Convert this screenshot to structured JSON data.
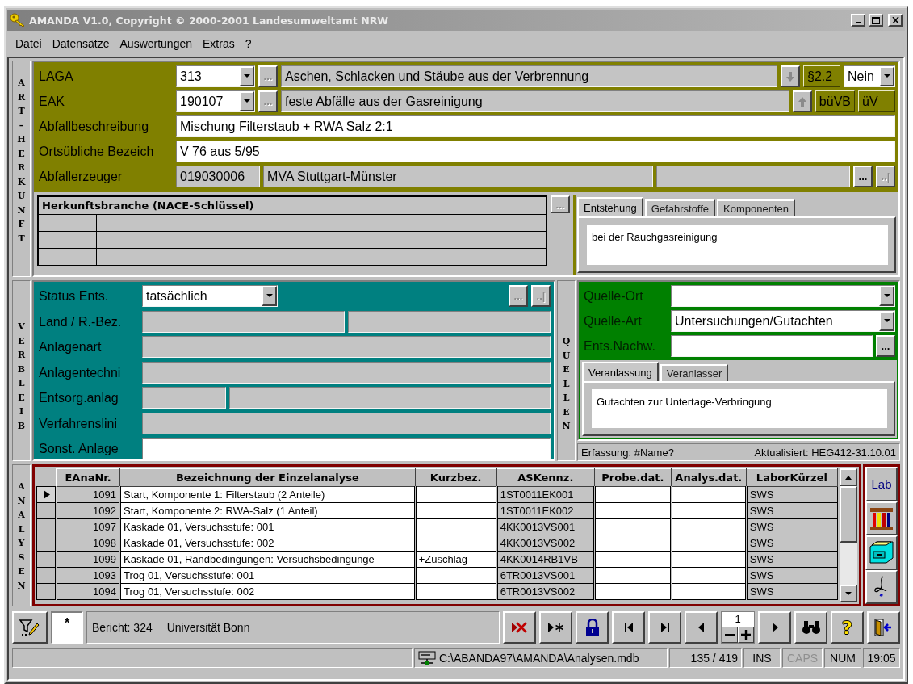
{
  "window": {
    "title": "AMANDA V1.0, Copyright © 2000-2001 Landesumweltamt NRW"
  },
  "menu": [
    "Datei",
    "Datensätze",
    "Auswertungen",
    "Extras",
    "?"
  ],
  "origin": {
    "side_label": "ART–HERKUNFT",
    "rows": [
      {
        "label": "LAGA",
        "items": [
          {
            "kind": "combo",
            "text": "313"
          },
          {
            "kind": "button",
            "text": "...",
            "disabled": true
          },
          {
            "kind": "field",
            "text": "Aschen, Schlacken und Stäube aus der Verbrennung",
            "readonly": true
          },
          {
            "kind": "down_arrow",
            "disabled": true
          },
          {
            "kind": "tag",
            "text": "§2.2"
          },
          {
            "kind": "combo",
            "text": "Nein"
          }
        ]
      },
      {
        "label": "EAK",
        "items": [
          {
            "kind": "combo",
            "text": "190107"
          },
          {
            "kind": "button",
            "text": "...",
            "disabled": true
          },
          {
            "kind": "field",
            "text": "feste Abfälle aus der Gasreinigung",
            "readonly": true
          },
          {
            "kind": "up_arrow",
            "disabled": true
          },
          {
            "kind": "tag",
            "text": "büVB"
          },
          {
            "kind": "tag",
            "text": "üV"
          }
        ]
      },
      {
        "label": "Abfallbeschreibung",
        "items": [
          {
            "kind": "field",
            "text": "Mischung Filterstaub + RWA Salz  2:1",
            "readonly": false
          }
        ]
      },
      {
        "label": "Ortsübliche Bezeich",
        "items": [
          {
            "kind": "field",
            "text": "V 76 aus 5/95",
            "readonly": false
          }
        ]
      },
      {
        "label": "Abfallerzeuger",
        "items": [
          {
            "kind": "field",
            "text": "019030006",
            "readonly": true
          },
          {
            "kind": "field",
            "text": "MVA Stuttgart-Münster",
            "readonly": true
          },
          {
            "kind": "field",
            "readonly": true
          },
          {
            "kind": "button",
            "text": "...",
            "disabled": false
          },
          {
            "kind": "button",
            "text": "..|",
            "disabled": true
          }
        ]
      }
    ],
    "branch_table": {
      "title": "Herkunftsbranche (NACE-Schlüssel)"
    },
    "branch_lookup": {
      "text": "...",
      "disabled": true
    },
    "tabs": [
      {
        "label": "Entstehung",
        "selected": true
      },
      {
        "label": "Gefahrstoffe",
        "selected": false
      },
      {
        "label": "Komponenten",
        "selected": false
      }
    ],
    "tab_content": "bei der Rauchgasreinigung"
  },
  "disposal": {
    "side_label": "VERBLEIB",
    "rows": [
      {
        "label": "Status Ents.",
        "items": [
          {
            "kind": "combo",
            "text": "tatsächlich"
          },
          {
            "kind": "button",
            "text": "...",
            "disabled": true
          },
          {
            "kind": "button",
            "text": "..|",
            "disabled": true
          }
        ]
      },
      {
        "label": "Land / R.-Bez.",
        "items": [
          {
            "kind": "field",
            "readonly": true
          },
          {
            "kind": "field",
            "readonly": true
          }
        ]
      },
      {
        "label": "Anlagenart",
        "items": [
          {
            "kind": "field",
            "readonly": true
          }
        ]
      },
      {
        "label": "Anlagentechni",
        "items": [
          {
            "kind": "field",
            "readonly": true
          }
        ]
      },
      {
        "label": "Entsorg.anlag",
        "items": [
          {
            "kind": "field",
            "readonly": true
          },
          {
            "kind": "field",
            "readonly": true
          }
        ]
      },
      {
        "label": "Verfahrenslini",
        "items": [
          {
            "kind": "field",
            "readonly": true
          }
        ]
      },
      {
        "label": "Sonst. Anlage",
        "items": [
          {
            "kind": "field",
            "readonly": false
          }
        ]
      }
    ]
  },
  "sources": {
    "side_label": "QUELLEN",
    "rows": [
      {
        "label": "Quelle-Ort",
        "items": [
          {
            "kind": "combo"
          }
        ]
      },
      {
        "label": "Quelle-Art",
        "items": [
          {
            "kind": "combo",
            "text": "Untersuchungen/Gutachten"
          }
        ]
      },
      {
        "label": "Ents.Nachw.",
        "items": [
          {
            "kind": "field",
            "readonly": false
          },
          {
            "kind": "button",
            "text": "...",
            "disabled": false
          }
        ]
      }
    ],
    "tabs": [
      {
        "label": "Veranlassung",
        "selected": true
      },
      {
        "label": "Veranlasser",
        "selected": false
      }
    ],
    "tab_content": "Gutachten zur Untertage-Verbringung",
    "created": "Erfassung: #Name?",
    "updated": "Aktualisiert: HEG412-31.10.01"
  },
  "analyses": {
    "side_label": "ANALYSEN",
    "columns": [
      "EAnaNr.",
      "Bezeichnung der Einzelanalyse",
      "Kurzbez.",
      "ASKennz.",
      "Probe.dat.",
      "Analys.dat.",
      "LaborKürzel"
    ],
    "rows": [
      {
        "selected": true,
        "number": "1091",
        "description": "Start, Komponente 1: Filterstaub (2 Anteile)",
        "code": "1ST0011EK001",
        "lab": "SWS"
      },
      {
        "selected": false,
        "number": "1092",
        "description": "Start, Komponente 2: RWA-Salz (1 Anteil)",
        "code": "1ST0011EK002",
        "lab": "SWS"
      },
      {
        "selected": false,
        "number": "1097",
        "description": "Kaskade 01, Versuchsstufe: 001",
        "code": "4KK0013VS001",
        "lab": "SWS"
      },
      {
        "selected": false,
        "number": "1098",
        "description": "Kaskade 01, Versuchsstufe: 002",
        "code": "4KK0013VS002",
        "lab": "SWS"
      },
      {
        "selected": false,
        "number": "1099",
        "description": "Kaskade 01, Randbedingungen: Versuchsbedingunge",
        "short": "+Zuschlag",
        "code": "4KK0014RB1VB",
        "lab": "SWS"
      },
      {
        "selected": false,
        "number": "1093",
        "description": "Trog 01, Versuchsstufe: 001",
        "code": "6TR0013VS001",
        "lab": "SWS"
      },
      {
        "selected": false,
        "number": "1094",
        "description": "Trog 01, Versuchsstufe: 002",
        "code": "6TR0013VS002",
        "lab": "SWS"
      }
    ],
    "lab_button": "Lab"
  },
  "toolbar": {
    "marker": "*",
    "report": "Bericht: 324",
    "institution": "Universität Bonn",
    "page": "1",
    "help": "?"
  },
  "status_bar": {
    "path": "C:\\ABANDA97\\AMANDA\\Analysen.mdb",
    "records": "135 / 419",
    "indicators": [
      {
        "label": "INS",
        "on": true
      },
      {
        "label": "CAPS",
        "on": false
      },
      {
        "label": "NUM",
        "on": true
      }
    ],
    "time": "19:05"
  }
}
